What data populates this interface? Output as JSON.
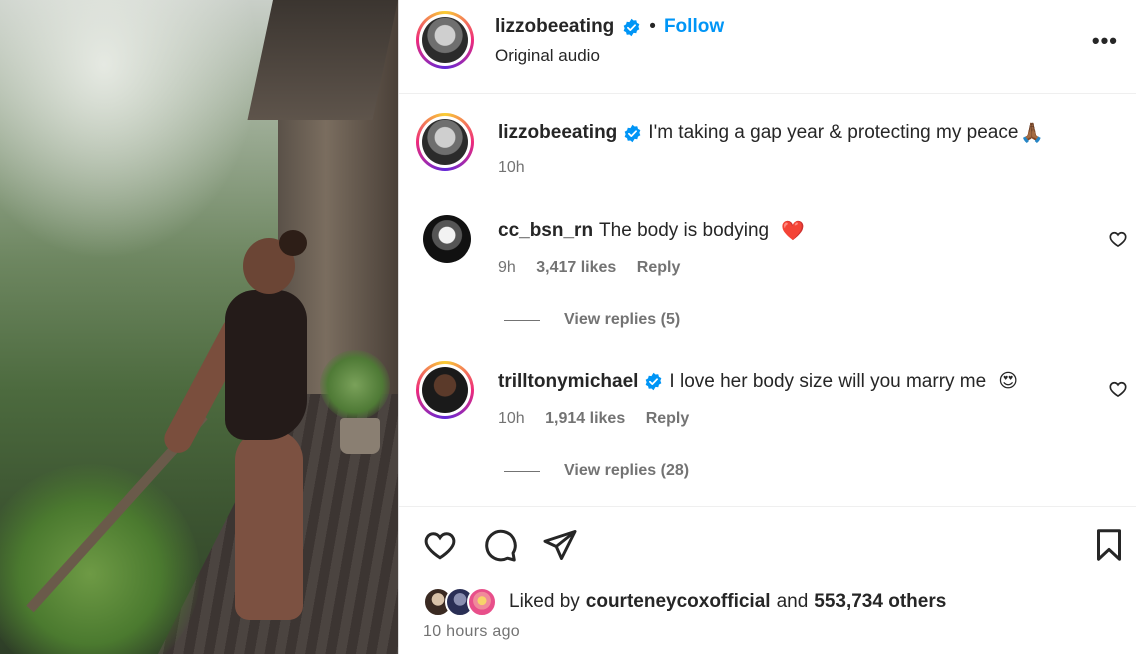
{
  "post": {
    "username": "lizzobeeating",
    "follow_label": "Follow",
    "separator": "•",
    "audio": "Original audio",
    "more_label": "•••"
  },
  "caption": {
    "username": "lizzobeeating",
    "text": "I'm taking a gap year & protecting my peace",
    "emoji": "🙏🏾",
    "time": "10h"
  },
  "comments": [
    {
      "username": "cc_bsn_rn",
      "text": "The body is bodying",
      "emoji": "❤️",
      "time": "9h",
      "likes": "3,417 likes",
      "reply_label": "Reply",
      "view_replies": "View replies (5)"
    },
    {
      "username": "trilltonymichael",
      "text": "I love her body size will you marry me",
      "emoji": "😍",
      "time": "10h",
      "likes": "1,914 likes",
      "reply_label": "Reply",
      "view_replies": "View replies (28)"
    }
  ],
  "likes": {
    "prefix": "Liked by",
    "user": "courteneycoxofficial",
    "and": "and",
    "others": "553,734 others"
  },
  "timestamp": "10 hours ago",
  "colors": {
    "accent_blue": "#0095f6",
    "verified_blue": "#0095f6",
    "muted_text": "#737373"
  },
  "icons": [
    "verified-badge-icon",
    "more-options-icon",
    "heart-icon",
    "comment-icon",
    "share-icon",
    "save-icon"
  ]
}
